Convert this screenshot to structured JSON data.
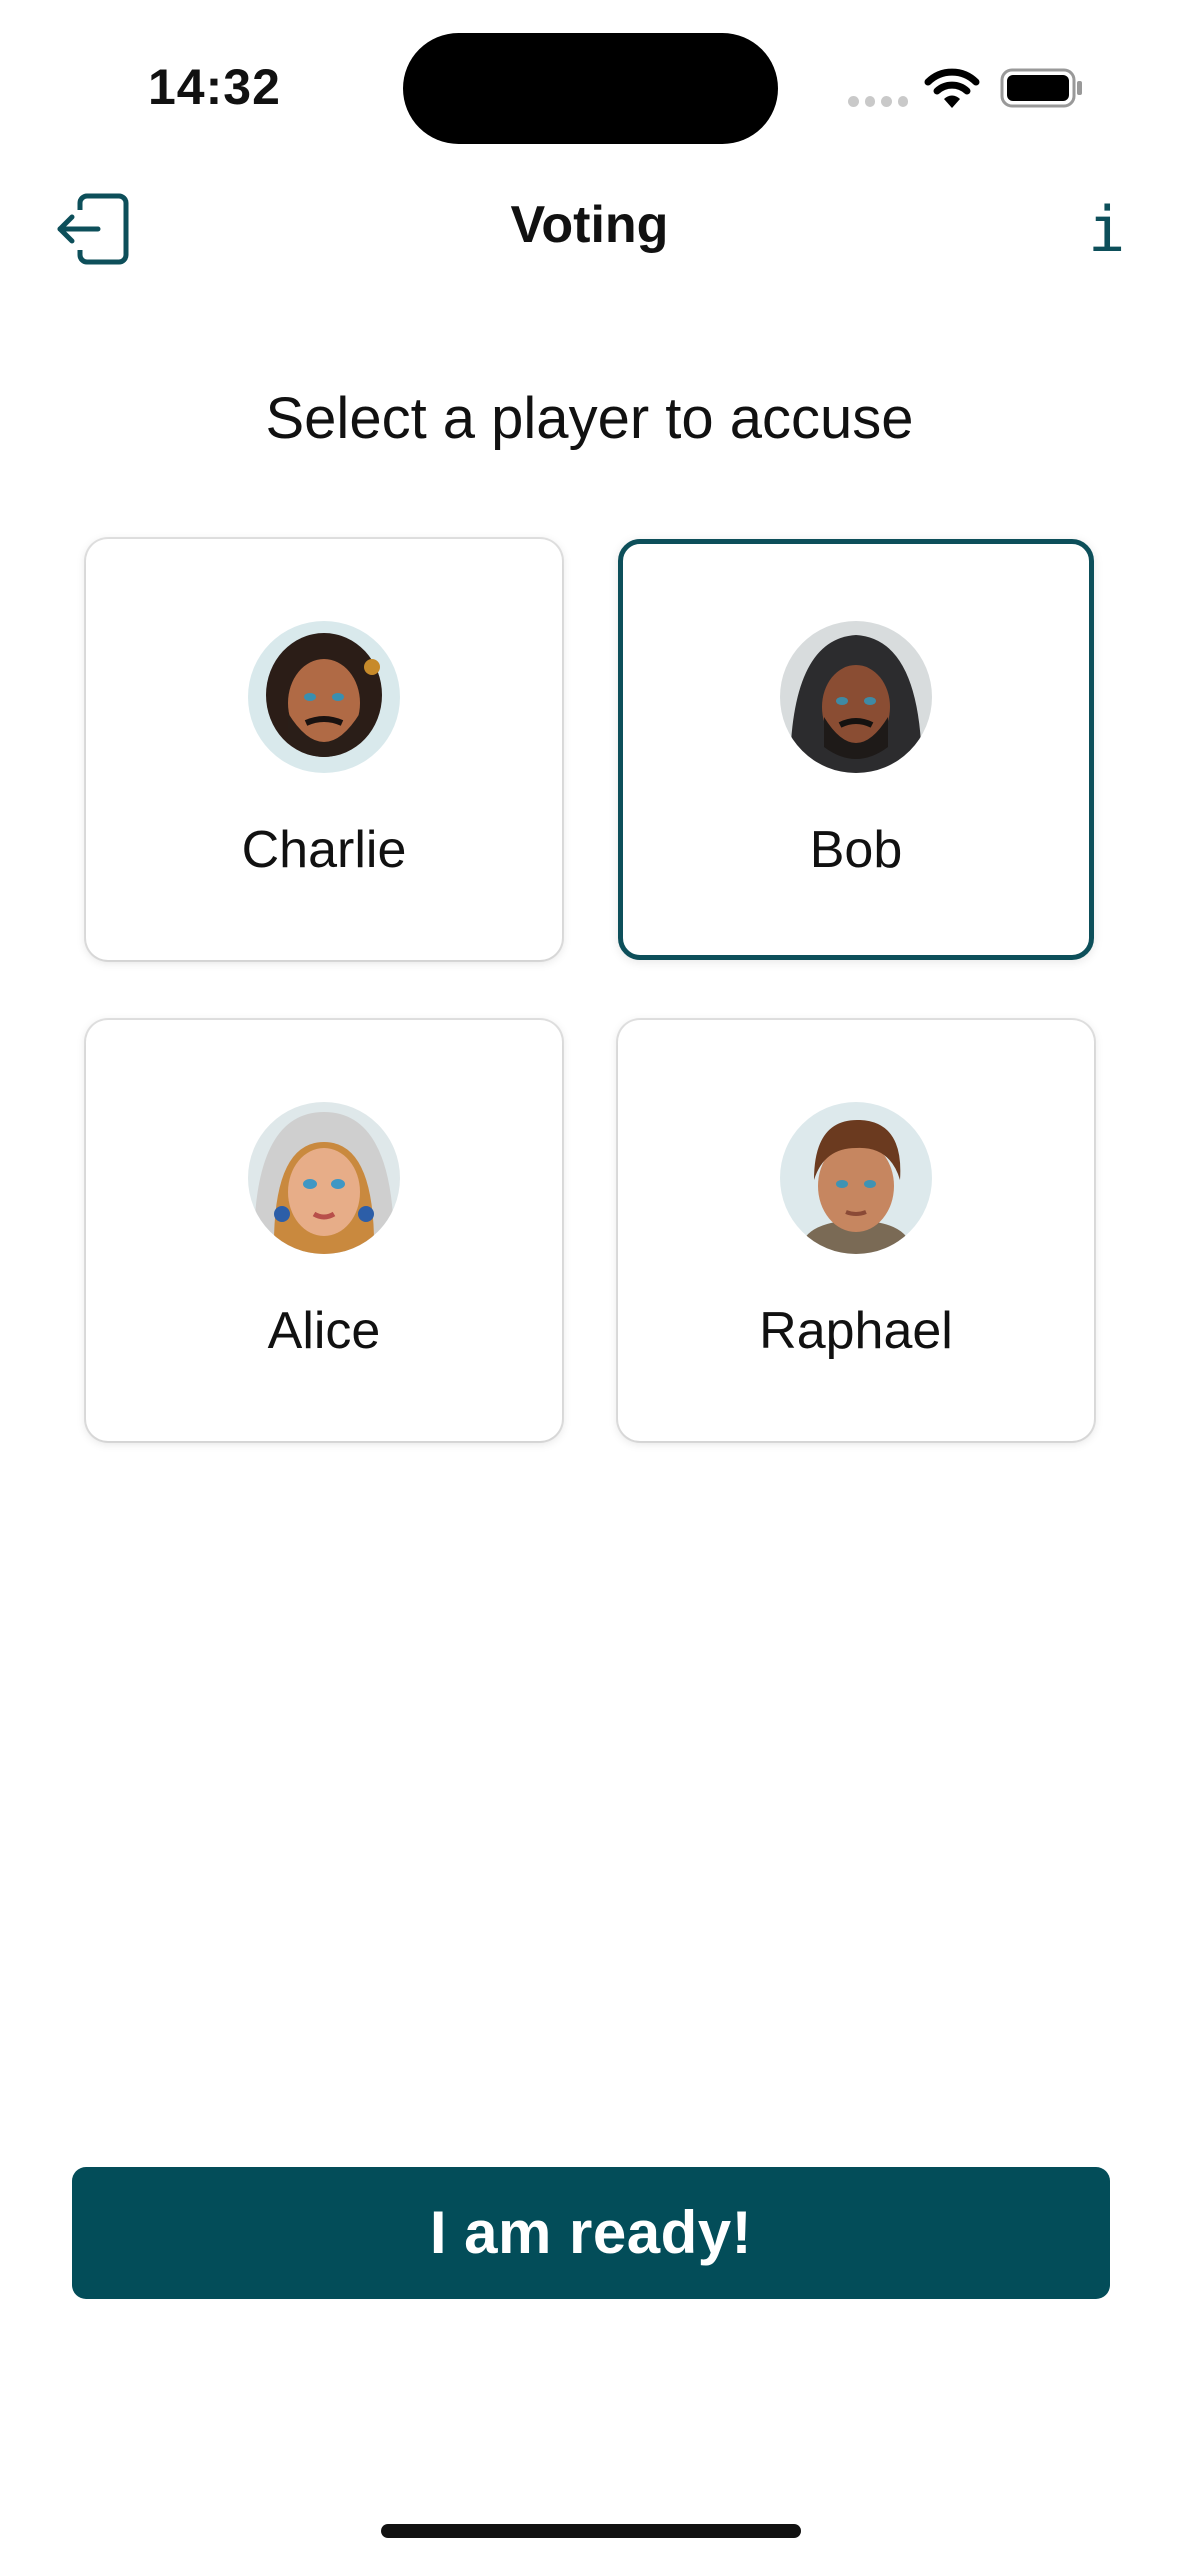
{
  "status_bar": {
    "time": "14:32"
  },
  "nav": {
    "title": "Voting",
    "exit_icon": "exit-door-icon",
    "info_label": "i"
  },
  "prompt": "Select a player to accuse",
  "players": [
    {
      "name": "Charlie",
      "selected": false,
      "avatar": "bearded-man-portrait"
    },
    {
      "name": "Bob",
      "selected": true,
      "avatar": "hooded-man-portrait"
    },
    {
      "name": "Alice",
      "selected": false,
      "avatar": "woman-headscarf-portrait"
    },
    {
      "name": "Raphael",
      "selected": false,
      "avatar": "young-man-portrait"
    }
  ],
  "ready_button": "I am ready!",
  "colors": {
    "accent": "#034d59",
    "selected_border": "#0d4f5a"
  }
}
